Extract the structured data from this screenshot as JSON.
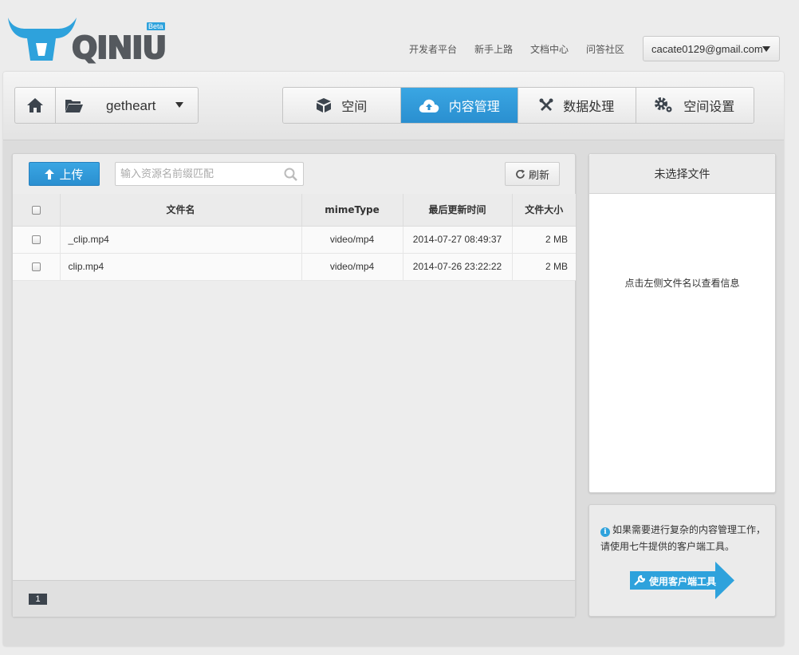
{
  "brand": {
    "logo_text": "QINIU",
    "badge": "Beta",
    "accent": "#2ea2dc"
  },
  "top_nav": {
    "links": [
      "开发者平台",
      "新手上路",
      "文档中心",
      "问答社区"
    ],
    "user_email": "cacate0129@gmail.com"
  },
  "bucket": {
    "name": "getheart",
    "home_icon": "home-icon",
    "folder_icon": "folder-open-icon"
  },
  "tabs": [
    {
      "label": "空间",
      "icon": "box-icon",
      "active": false
    },
    {
      "label": "内容管理",
      "icon": "cloud-upload-icon",
      "active": true
    },
    {
      "label": "数据处理",
      "icon": "tools-icon",
      "active": false
    },
    {
      "label": "空间设置",
      "icon": "gears-icon",
      "active": false
    }
  ],
  "toolbar": {
    "upload_label": "上传",
    "search_placeholder": "输入资源名前缀匹配",
    "refresh_label": "刷新"
  },
  "table": {
    "columns": [
      "文件名",
      "mimeType",
      "最后更新时间",
      "文件大小"
    ],
    "rows": [
      {
        "name": "_clip.mp4",
        "mime": "video/mp4",
        "updated": "2014-07-27 08:49:37",
        "size": "2 MB"
      },
      {
        "name": "clip.mp4",
        "mime": "video/mp4",
        "updated": "2014-07-26 23:22:22",
        "size": "2 MB"
      }
    ]
  },
  "pagination": {
    "current_page": "1"
  },
  "info_panel": {
    "title": "未选择文件",
    "hint": "点击左侧文件名以查看信息"
  },
  "tool_box": {
    "message_line1": "如果需要进行复杂的内容管理工作，",
    "message_line2": "请使用七牛提供的客户端工具。",
    "button_label": "使用客户端工具",
    "info_icon_char": "i"
  }
}
